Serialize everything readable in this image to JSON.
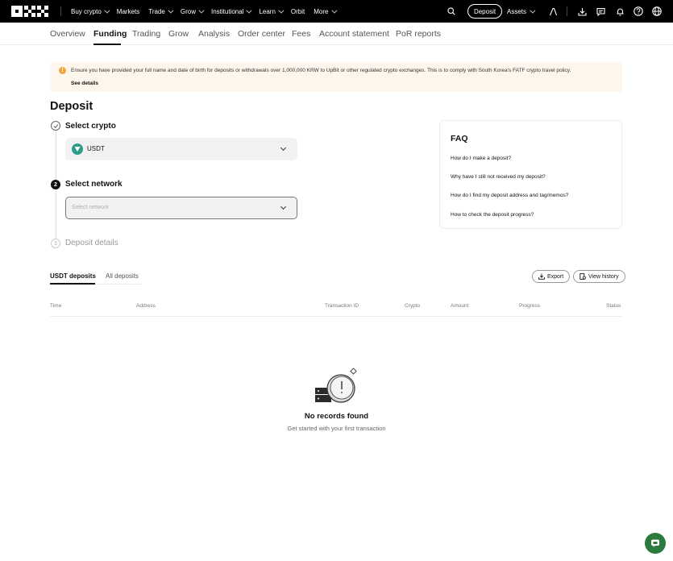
{
  "topnav": {
    "items": [
      {
        "label": "Buy crypto",
        "dropdown": true
      },
      {
        "label": "Markets",
        "dropdown": false
      },
      {
        "label": "Trade",
        "dropdown": true
      },
      {
        "label": "Grow",
        "dropdown": true
      },
      {
        "label": "Institutional",
        "dropdown": true
      },
      {
        "label": "Learn",
        "dropdown": true
      },
      {
        "label": "Orbit",
        "dropdown": false
      },
      {
        "label": "More",
        "dropdown": true
      }
    ],
    "deposit_label": "Deposit",
    "assets_label": "Assets",
    "icons": [
      "search-icon",
      "profile-icon",
      "download-icon",
      "message-icon",
      "bell-icon",
      "help-icon",
      "globe-icon"
    ]
  },
  "subnav": {
    "items": [
      "Overview",
      "Funding",
      "Trading",
      "Grow",
      "Analysis",
      "Order center",
      "Fees",
      "Account statement",
      "PoR reports"
    ],
    "active": "Funding"
  },
  "banner": {
    "text": "Ensure you have provided your full name and date of birth for deposits or withdrawals over 1,000,000 KRW to UpBit or other regulated crypto exchanges. This is to comply with South Korea's FATF crypto travel policy.",
    "link": "See details",
    "accent_color": "#f0a63c"
  },
  "deposit": {
    "title": "Deposit",
    "steps": [
      {
        "number": "1",
        "label": "Select crypto",
        "state": "done"
      },
      {
        "number": "2",
        "label": "Select network",
        "state": "active"
      },
      {
        "number": "3",
        "label": "Deposit details",
        "state": "pending"
      }
    ],
    "crypto_value": "USDT",
    "network_placeholder": "Select network"
  },
  "faq": {
    "title": "FAQ",
    "items": [
      "How do I make a deposit?",
      "Why have I still not received my deposit?",
      "How do I find my deposit address and tag/memos?",
      "How to check the deposit progress?"
    ]
  },
  "history": {
    "tabs": [
      "USDT deposits",
      "All deposits"
    ],
    "active_tab": "USDT deposits",
    "export_label": "Export",
    "view_history_label": "View history",
    "columns": [
      "Time",
      "Address",
      "Transaction ID",
      "Crypto",
      "Amount",
      "Progress",
      "Status"
    ],
    "empty_title": "No records found",
    "empty_subtitle": "Get started with your first transaction"
  }
}
